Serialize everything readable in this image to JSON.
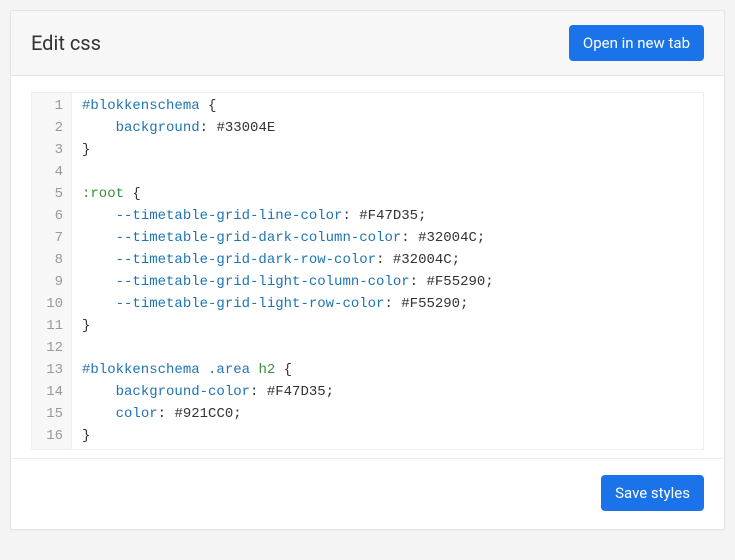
{
  "header": {
    "title": "Edit css",
    "open_button_label": "Open in new tab"
  },
  "footer": {
    "save_button_label": "Save styles"
  },
  "editor": {
    "lines": [
      {
        "num": 1,
        "tokens": [
          [
            "selector",
            "#blokkenschema"
          ],
          [
            "",
            ""
          ],
          [
            "brace",
            "{"
          ]
        ],
        "join": " "
      },
      {
        "num": 2,
        "indent": 4,
        "tokens": [
          [
            "prop",
            "background"
          ],
          [
            "punct",
            ":"
          ],
          [
            "",
            ""
          ],
          [
            "val",
            "#33004E"
          ]
        ],
        "join": " "
      },
      {
        "num": 3,
        "tokens": [
          [
            "brace",
            "}"
          ]
        ]
      },
      {
        "num": 4,
        "tokens": []
      },
      {
        "num": 5,
        "tokens": [
          [
            "pseudo",
            ":root"
          ],
          [
            "",
            ""
          ],
          [
            "brace",
            "{"
          ]
        ],
        "join": " "
      },
      {
        "num": 6,
        "indent": 4,
        "tokens": [
          [
            "prop",
            "--timetable-grid-line-color"
          ],
          [
            "punct",
            ":"
          ],
          [
            "",
            ""
          ],
          [
            "val",
            "#F47D35"
          ],
          [
            "punct",
            ";"
          ]
        ],
        "join": " "
      },
      {
        "num": 7,
        "indent": 4,
        "tokens": [
          [
            "prop",
            "--timetable-grid-dark-column-color"
          ],
          [
            "punct",
            ":"
          ],
          [
            "",
            ""
          ],
          [
            "val",
            "#32004C"
          ],
          [
            "punct",
            ";"
          ]
        ],
        "join": " "
      },
      {
        "num": 8,
        "indent": 4,
        "tokens": [
          [
            "prop",
            "--timetable-grid-dark-row-color"
          ],
          [
            "punct",
            ":"
          ],
          [
            "",
            ""
          ],
          [
            "val",
            "#32004C"
          ],
          [
            "punct",
            ";"
          ]
        ],
        "join": " "
      },
      {
        "num": 9,
        "indent": 4,
        "tokens": [
          [
            "prop",
            "--timetable-grid-light-column-color"
          ],
          [
            "punct",
            ":"
          ],
          [
            "",
            ""
          ],
          [
            "val",
            "#F55290"
          ],
          [
            "punct",
            ";"
          ]
        ],
        "join": " "
      },
      {
        "num": 10,
        "indent": 4,
        "tokens": [
          [
            "prop",
            "--timetable-grid-light-row-color"
          ],
          [
            "punct",
            ":"
          ],
          [
            "",
            ""
          ],
          [
            "val",
            "#F55290"
          ],
          [
            "punct",
            ";"
          ]
        ],
        "join": " "
      },
      {
        "num": 11,
        "tokens": [
          [
            "brace",
            "}"
          ]
        ]
      },
      {
        "num": 12,
        "tokens": []
      },
      {
        "num": 13,
        "tokens": [
          [
            "selector",
            "#blokkenschema"
          ],
          [
            "",
            ""
          ],
          [
            "class",
            ".area"
          ],
          [
            "",
            ""
          ],
          [
            "tag",
            "h2"
          ],
          [
            "",
            ""
          ],
          [
            "brace",
            "{"
          ]
        ],
        "join": " "
      },
      {
        "num": 14,
        "indent": 4,
        "tokens": [
          [
            "prop",
            "background-color"
          ],
          [
            "punct",
            ":"
          ],
          [
            "",
            ""
          ],
          [
            "val",
            "#F47D35"
          ],
          [
            "punct",
            ";"
          ]
        ],
        "join": " "
      },
      {
        "num": 15,
        "indent": 4,
        "tokens": [
          [
            "prop",
            "color"
          ],
          [
            "punct",
            ":"
          ],
          [
            "",
            ""
          ],
          [
            "val",
            "#921CC0"
          ],
          [
            "punct",
            ";"
          ]
        ],
        "join": " "
      },
      {
        "num": 16,
        "tokens": [
          [
            "brace",
            "}"
          ]
        ]
      }
    ]
  }
}
